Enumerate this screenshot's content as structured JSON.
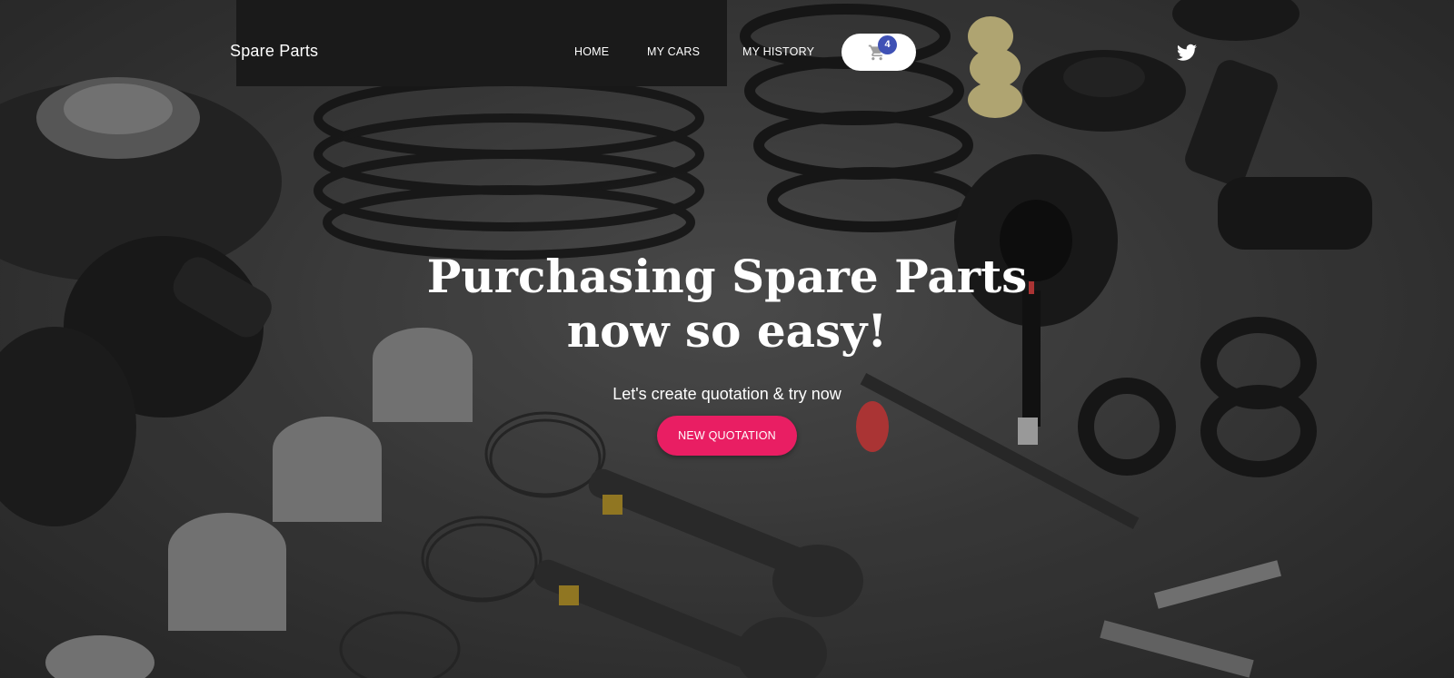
{
  "brand": {
    "name": "Spare Parts"
  },
  "nav": {
    "links": [
      {
        "label": "HOME"
      },
      {
        "label": "MY CARS"
      },
      {
        "label": "MY HISTORY"
      }
    ],
    "cart": {
      "count": "4",
      "icon": "shopping-cart-icon"
    },
    "social": {
      "icon": "twitter-icon"
    }
  },
  "hero": {
    "title_line1": "Purchasing Spare Parts",
    "title_line2": "now so easy!",
    "subtitle": "Let's create quotation & try now",
    "cta_label": "NEW QUOTATION"
  },
  "colors": {
    "accent": "#e91e63",
    "badge": "#3f51b5",
    "text": "#ffffff"
  }
}
